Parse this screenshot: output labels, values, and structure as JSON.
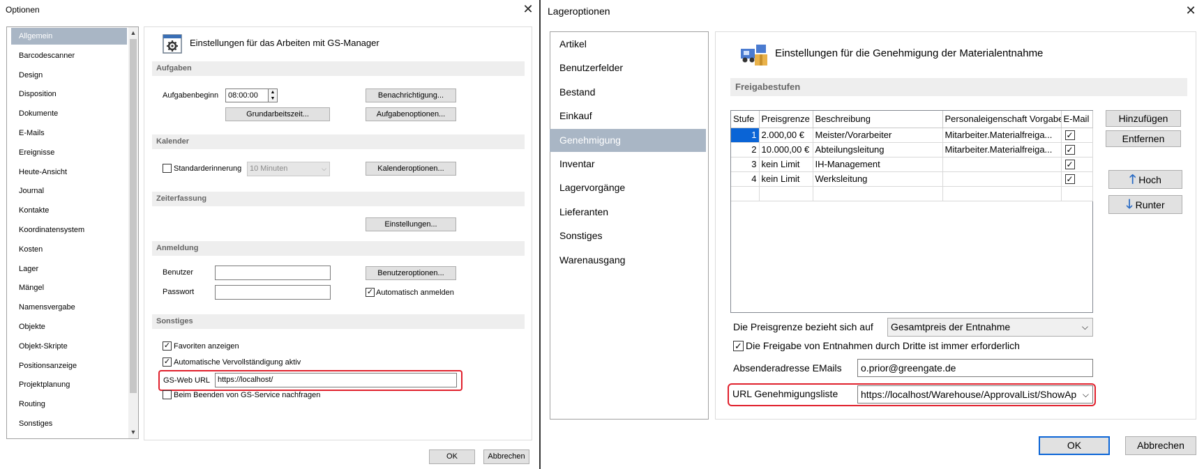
{
  "left_window": {
    "title": "Optionen",
    "nav_items": [
      "Allgemein",
      "Barcodescanner",
      "Design",
      "Disposition",
      "Dokumente",
      "E-Mails",
      "Ereignisse",
      "Heute-Ansicht",
      "Journal",
      "Kontakte",
      "Koordinatensystem",
      "Kosten",
      "Lager",
      "Mängel",
      "Namensvergabe",
      "Objekte",
      "Objekt-Skripte",
      "Positionsanzeige",
      "Projektplanung",
      "Routing",
      "Sonstiges"
    ],
    "selected_index": 0,
    "header": "Einstellungen für das Arbeiten mit GS-Manager",
    "sections": {
      "aufgaben": {
        "title": "Aufgaben",
        "start_label": "Aufgabenbeginn",
        "start_value": "08:00:00",
        "notify_btn": "Benachrichtigung...",
        "worktime_btn": "Grundarbeitszeit...",
        "taskopts_btn": "Aufgabenoptionen..."
      },
      "kalender": {
        "title": "Kalender",
        "reminder_label": "Standarderinnerung",
        "reminder_value": "10 Minuten",
        "calopts_btn": "Kalenderoptionen..."
      },
      "zeiterfassung": {
        "title": "Zeiterfassung",
        "settings_btn": "Einstellungen..."
      },
      "anmeldung": {
        "title": "Anmeldung",
        "user_label": "Benutzer",
        "user_value": "",
        "pass_label": "Passwort",
        "pass_value": "",
        "useropts_btn": "Benutzeroptionen...",
        "auto_login_label": "Automatisch anmelden"
      },
      "sonstiges": {
        "title": "Sonstiges",
        "fav_label": "Favoriten anzeigen",
        "autocomplete_label": "Automatische Vervollständigung aktiv",
        "weburl_label": "GS-Web URL",
        "weburl_value": "https://localhost/",
        "ask_label": "Beim Beenden von GS-Service nachfragen"
      }
    },
    "ok": "OK",
    "cancel": "Abbrechen"
  },
  "right_window": {
    "title": "Lageroptionen",
    "nav_items": [
      "Artikel",
      "Benutzerfelder",
      "Bestand",
      "Einkauf",
      "Genehmigung",
      "Inventar",
      "Lagervorgänge",
      "Lieferanten",
      "Sonstiges",
      "Warenausgang"
    ],
    "selected_index": 4,
    "header": "Einstellungen für die Genehmigung der Materialentnahme",
    "section_title": "Freigabestufen",
    "table": {
      "columns": [
        "Stufe",
        "Preisgrenze",
        "Beschreibung",
        "Personaleigenschaft Vorgabe",
        "E-Mail"
      ],
      "rows": [
        {
          "stufe": "1",
          "preis": "2.000,00 €",
          "beschreibung": "Meister/Vorarbeiter",
          "personal": "Mitarbeiter.Materialfreiga...",
          "email": true
        },
        {
          "stufe": "2",
          "preis": "10.000,00 €",
          "beschreibung": "Abteilungsleitung",
          "personal": "Mitarbeiter.Materialfreiga...",
          "email": true
        },
        {
          "stufe": "3",
          "preis": "kein Limit",
          "beschreibung": "IH-Management",
          "personal": "",
          "email": true
        },
        {
          "stufe": "4",
          "preis": "kein Limit",
          "beschreibung": "Werksleitung",
          "personal": "",
          "email": true
        }
      ]
    },
    "add_btn": "Hinzufügen",
    "remove_btn": "Entfernen",
    "up_btn": "Hoch",
    "down_btn": "Runter",
    "price_label": "Die Preisgrenze bezieht sich auf",
    "price_value": "Gesamtpreis der Entnahme",
    "third_party_label": "Die Freigabe von Entnahmen durch Dritte ist immer erforderlich",
    "sender_label": "Absenderadresse EMails",
    "sender_value": "o.prior@greengate.de",
    "url_label": "URL Genehmigungsliste",
    "url_value": "https://localhost/Warehouse/ApprovalList/ShowAp",
    "ok": "OK",
    "cancel": "Abbrechen"
  }
}
